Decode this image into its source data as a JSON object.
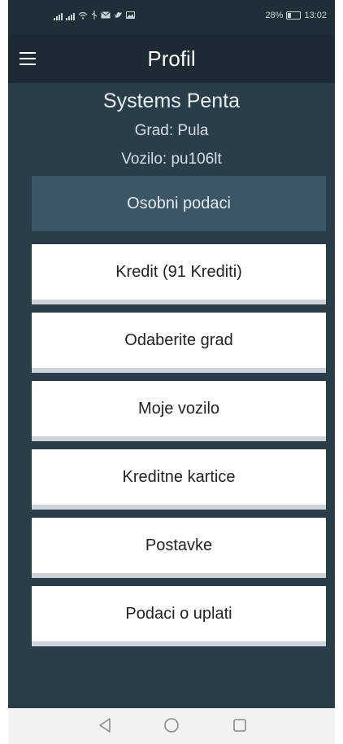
{
  "status_bar": {
    "battery_percent": "28%",
    "time": "13:02"
  },
  "header": {
    "title": "Profil"
  },
  "profile": {
    "name": "Systems Penta",
    "city_line": "Grad: Pula",
    "vehicle_line": "Vozilo: pu106lt",
    "personal_data_label": "Osobni podaci"
  },
  "menu": {
    "items": [
      {
        "label": "Kredit (91 Krediti)"
      },
      {
        "label": "Odaberite grad"
      },
      {
        "label": "Moje vozilo"
      },
      {
        "label": "Kreditne kartice"
      },
      {
        "label": "Postavke"
      },
      {
        "label": "Podaci o uplati"
      }
    ]
  },
  "icons": {
    "menu": "hamburger-icon",
    "nav_back": "back-triangle-icon",
    "nav_home": "home-circle-icon",
    "nav_recent": "recent-square-icon"
  },
  "colors": {
    "background": "#2a3e4a",
    "app_bar": "#1b2a33",
    "status_bar": "#1f2f38",
    "personal_data_button": "#3b5666",
    "card": "#ffffff"
  }
}
